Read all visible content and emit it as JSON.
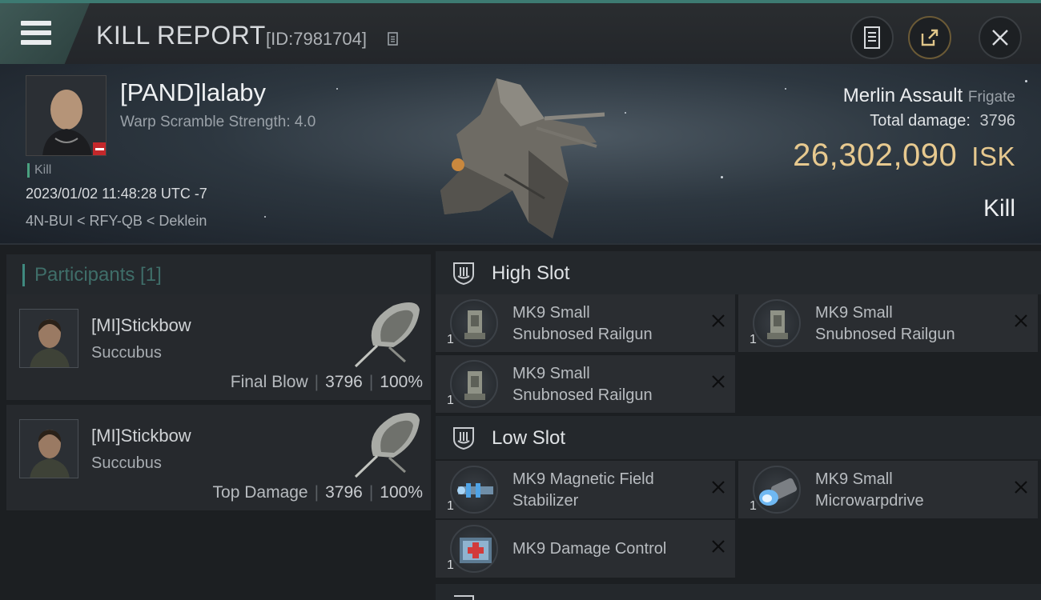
{
  "header": {
    "title": "KILL REPORT",
    "report_id": "[ID:7981704]",
    "icons": [
      "menu-icon",
      "copy-icon",
      "document-icon",
      "share-icon",
      "close-icon"
    ]
  },
  "victim": {
    "name": "[PAND]lalaby",
    "warp_scramble": "Warp Scramble Strength: 4.0",
    "tag": "Kill",
    "datetime": "2023/01/02 11:48:28 UTC -7",
    "location": "4N-BUI < RFY-QB < Deklein",
    "ship_name": "Merlin Assault",
    "ship_class": "Frigate",
    "total_damage_label": "Total damage:",
    "total_damage_value": "3796",
    "isk_value": "26,302,090",
    "isk_unit": "ISK",
    "result": "Kill"
  },
  "participants": {
    "header": "Participants [1]",
    "rows": [
      {
        "name": "[MI]Stickbow",
        "ship": "Succubus",
        "role": "Final Blow",
        "damage": "3796",
        "percent": "100%"
      },
      {
        "name": "[MI]Stickbow",
        "ship": "Succubus",
        "role": "Top Damage",
        "damage": "3796",
        "percent": "100%"
      }
    ]
  },
  "fitting": {
    "high_slot": {
      "label": "High Slot",
      "items": [
        {
          "line1": "MK9 Small",
          "line2": "Snubnosed Railgun",
          "qty": "1"
        },
        {
          "line1": "MK9 Small",
          "line2": "Snubnosed Railgun",
          "qty": "1"
        },
        {
          "line1": "MK9 Small",
          "line2": "Snubnosed Railgun",
          "qty": "1"
        }
      ]
    },
    "low_slot": {
      "label": "Low Slot",
      "items": [
        {
          "line1": "MK9 Magnetic Field",
          "line2": "Stabilizer",
          "qty": "1"
        },
        {
          "line1": "MK9 Small",
          "line2": "Microwarpdrive",
          "qty": "1"
        },
        {
          "line1": "MK9 Damage Control",
          "line2": "",
          "qty": "1"
        }
      ]
    }
  },
  "colors": {
    "accent": "#3f8a80",
    "isk": "#e7c98f",
    "kill_tag": "#4aa17f"
  }
}
